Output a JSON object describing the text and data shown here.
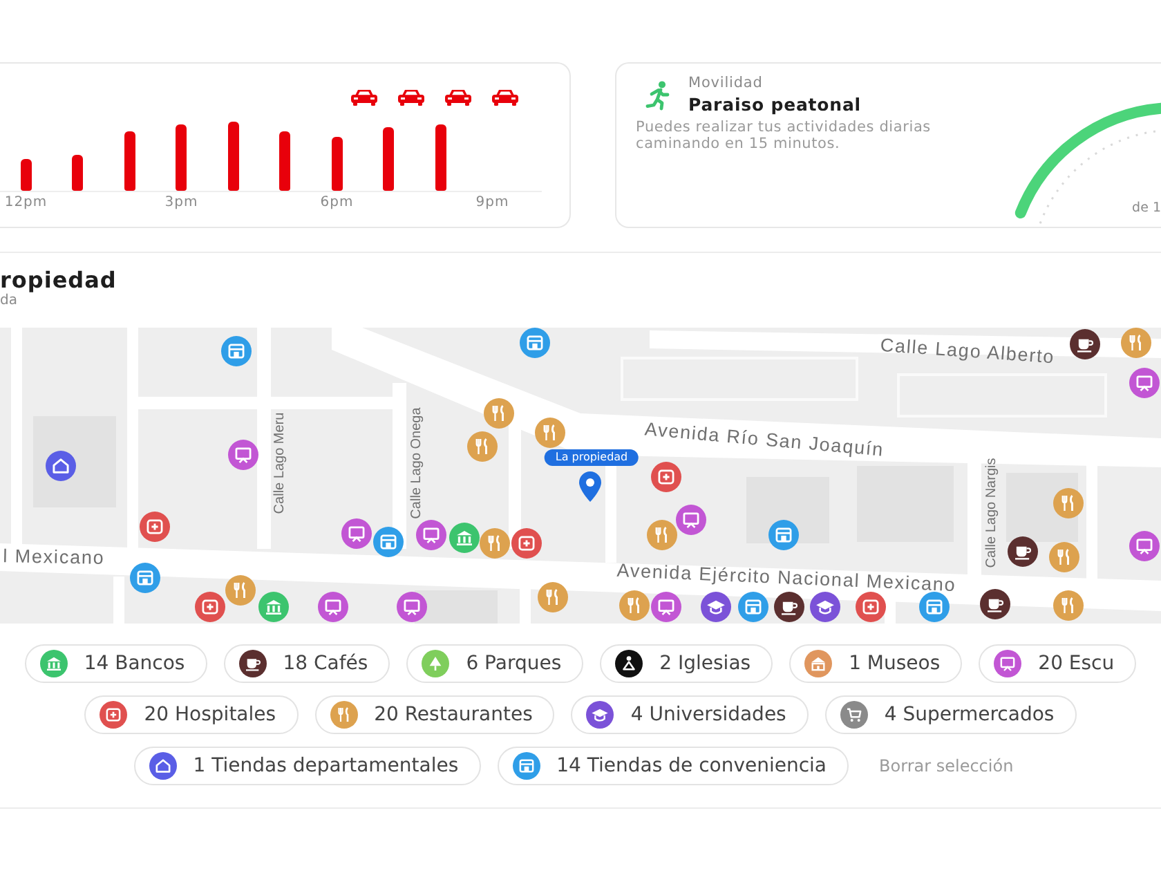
{
  "traffic_chart": {
    "x_labels": [
      "12pm",
      "3pm",
      "6pm",
      "9pm"
    ]
  },
  "mobility_card": {
    "category": "Movilidad",
    "title": "Paraiso peatonal",
    "description": "Puedes realizar tus actividades diarias caminando en 15 minutos.",
    "gauge_caption": "de 1"
  },
  "section": {
    "title": "ropiedad",
    "subtitle": "da"
  },
  "map": {
    "property_label": "La propiedad",
    "street_labels": [
      {
        "text": "Calle Lago Alberto",
        "kind": "horizontal"
      },
      {
        "text": "Avenida Río San Joaquín",
        "kind": "horizontal"
      },
      {
        "text": "Avenida Ejército Nacional Mexicano",
        "kind": "horizontal"
      },
      {
        "text": "l Mexicano",
        "kind": "horizontal"
      },
      {
        "text": "Calle Lago Meru",
        "kind": "vertical"
      },
      {
        "text": "Calle Lago Onega",
        "kind": "vertical"
      },
      {
        "text": "Calle Lago Nargis",
        "kind": "vertical"
      }
    ]
  },
  "filter_chips": [
    {
      "label": "14 Bancos",
      "kind": "bank",
      "color": "#3cc46e"
    },
    {
      "label": "18 Cafés",
      "kind": "cafe",
      "color": "#5b2f2f"
    },
    {
      "label": "6 Parques",
      "kind": "park",
      "color": "#7fce5c"
    },
    {
      "label": "2 Iglesias",
      "kind": "church",
      "color": "#111111"
    },
    {
      "label": "1 Museos",
      "kind": "museum",
      "color": "#e0965e"
    },
    {
      "label": "20 Escu",
      "kind": "school",
      "color": "#c256d4"
    },
    {
      "label": "20 Hospitales",
      "kind": "hospital",
      "color": "#e0504f"
    },
    {
      "label": "20 Restaurantes",
      "kind": "restaurant",
      "color": "#dda24f"
    },
    {
      "label": "4 Universidades",
      "kind": "university",
      "color": "#7b52d8"
    },
    {
      "label": "4 Supermercados",
      "kind": "supermarket",
      "color": "#8a8a8a"
    },
    {
      "label": "1 Tiendas departamentales",
      "kind": "department",
      "color": "#5a5ee6"
    },
    {
      "label": "14 Tiendas de conveniencia",
      "kind": "convenience",
      "color": "#2f9ee8"
    }
  ],
  "clear_link": "Borrar selección"
}
